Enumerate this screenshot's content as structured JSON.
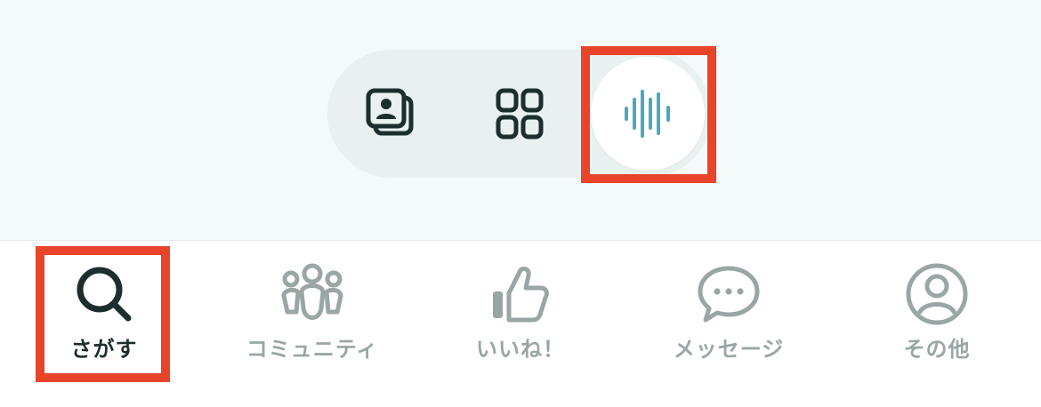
{
  "view_toggle": {
    "options": [
      {
        "icon": "profile-cards-icon",
        "selected": false
      },
      {
        "icon": "grid-icon",
        "selected": false
      },
      {
        "icon": "voice-waveform-icon",
        "selected": true
      }
    ]
  },
  "tabbar": {
    "tabs": [
      {
        "label": "さがす",
        "icon": "search-icon",
        "active": true
      },
      {
        "label": "コミュニティ",
        "icon": "community-icon",
        "active": false
      },
      {
        "label": "いいね！",
        "icon": "thumbs-up-icon",
        "active": false
      },
      {
        "label": "メッセージ",
        "icon": "chat-bubble-icon",
        "active": false
      },
      {
        "label": "その他",
        "icon": "user-circle-icon",
        "active": false
      }
    ]
  },
  "colors": {
    "top_background": "#f4f9f9",
    "toggle_background": "#e8f0f0",
    "icon_dark": "#1d2e2e",
    "icon_inactive": "#9aa6a6",
    "accent_teal": "#4aa8bf",
    "highlight_red": "#e8442a"
  }
}
